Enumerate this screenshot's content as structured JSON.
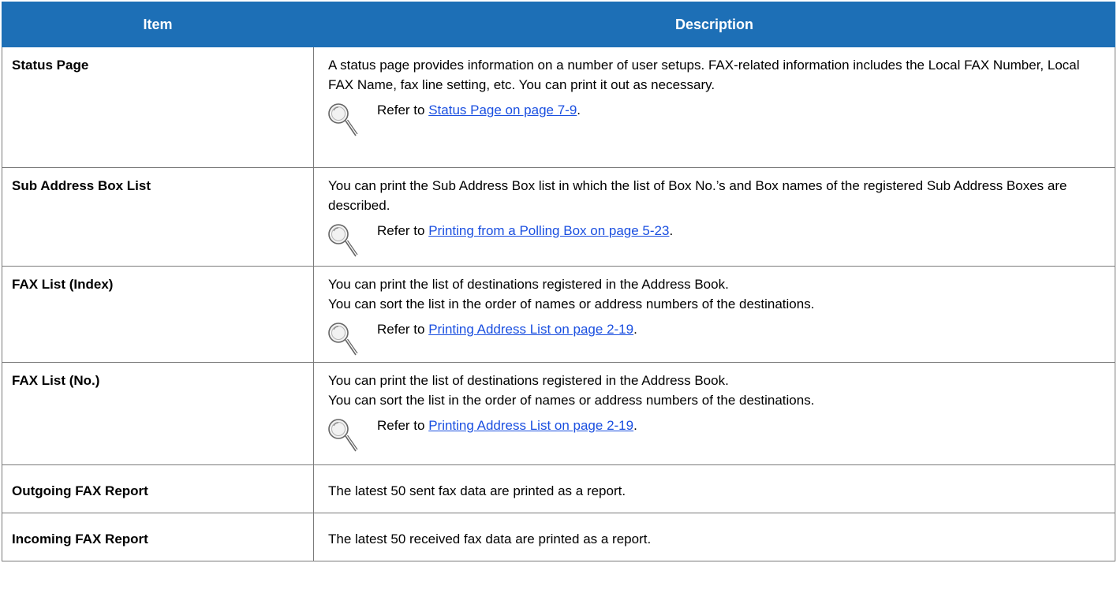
{
  "header": {
    "item": "Item",
    "description": "Description"
  },
  "rows": [
    {
      "item": "Status Page",
      "description": "A status page provides information on a number of user setups. FAX-related information includes the Local FAX Number, Local FAX Name, fax line setting, etc. You can print it out as necessary.",
      "ref_prefix": "Refer to ",
      "ref_link": "Status Page on page 7-9",
      "ref_suffix": "."
    },
    {
      "item": "Sub Address Box List",
      "description": "You can print the Sub Address Box list in which the list of Box No.’s and Box names of the registered Sub Address Boxes are described.",
      "ref_prefix": "Refer to ",
      "ref_link": "Printing from a Polling Box on page 5-23",
      "ref_suffix": "."
    },
    {
      "item": "FAX List (Index)",
      "description": "You can print the list of destinations registered in the Address Book.\nYou can sort the list in the order of names or address numbers of the destinations.",
      "ref_prefix": "Refer to ",
      "ref_link": "Printing Address List on page 2-19",
      "ref_suffix": "."
    },
    {
      "item": "FAX List (No.)",
      "description": "You can print the list of destinations registered in the Address Book.\nYou can sort the list in the order of names or address numbers of the destinations.",
      "ref_prefix": "Refer to ",
      "ref_link": "Printing Address List on page 2-19",
      "ref_suffix": "."
    },
    {
      "item": "Outgoing FAX Report",
      "description": "The latest 50 sent fax data are printed as a report."
    },
    {
      "item": "Incoming FAX Report",
      "description": "The latest 50 received fax data are printed as a report."
    }
  ],
  "icons": {
    "reference": "magnifier-icon"
  },
  "colors": {
    "header_bg": "#1d6fb6",
    "link": "#1a4fe0"
  }
}
